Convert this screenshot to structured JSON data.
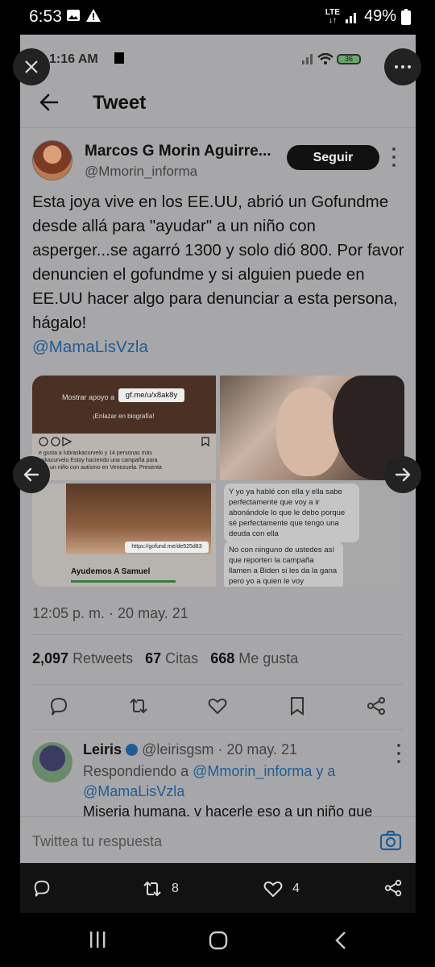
{
  "status": {
    "time": "6:53",
    "lte": "LTE",
    "battery": "49%"
  },
  "inner_status": {
    "time": "1:16 AM",
    "battery": "36"
  },
  "header": {
    "title": "Tweet"
  },
  "tweet": {
    "author_name": "Marcos G Morin Aguirre...",
    "author_handle": "@Mmorin_informa",
    "follow_label": "Seguir",
    "text": "Esta joya vive en los EE.UU, abrió un Gofundme desde allá para \"ayudar\" a un niño con asperger...se agarró 1300 y solo dió 800. Por favor denuncien el gofundme y si alguien puede en EE.UU hacer algo para denunciar a esta persona, hágalo!",
    "mention": "@MamaLisVzla",
    "timestamp": "12:05 p. m. · 20 may. 21",
    "retweets_count": "2,097",
    "retweets_label": "Retweets",
    "quotes_count": "67",
    "quotes_label": "Citas",
    "likes_count": "668",
    "likes_label": "Me gusta"
  },
  "media": {
    "tile1": {
      "support_label": "Mostrar apoyo a",
      "url": "gf.me/u/x8ak8y",
      "bio": "¡Enlazar en biografía!",
      "caption": "e gusta a lubraskacurvelo y 14 personas más\naskacurvelo Estoy haciendo una campaña para\nar a un niño con autismo en Venezuela. Presenta"
    },
    "tile3": {
      "url": "https://gofund.me/de525d83",
      "title": "Ayudemos A Samuel"
    },
    "tile4": {
      "msg1": "Y yo ya hablé con ella y ella sabe perfectamente que voy a ir abonándole lo que le debo porque sé perfectamente que tengo una deuda con ella",
      "msg2": "No con ninguno de ustedes así que reporten la campaña llamen a Biden si les da la gana pero yo a quien le voy"
    }
  },
  "reply": {
    "name": "Leiris",
    "handle_date": "@leirisgsm · 20 may. 21",
    "replying_to": "Respondiendo a",
    "reply_mentions": "@Mmorin_informa y a @MamaLisVzla",
    "text": "Miseria humana, y hacerle eso a un niño que"
  },
  "compose": {
    "placeholder": "Twittea tu respuesta"
  },
  "bottom_bar": {
    "retweets": "8",
    "likes": "4"
  }
}
